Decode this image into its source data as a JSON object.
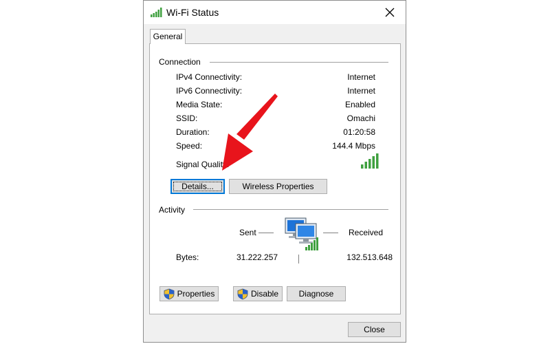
{
  "window": {
    "title": "Wi-Fi Status",
    "tab": "General",
    "close_label": "Close"
  },
  "connection": {
    "group_label": "Connection",
    "rows": [
      {
        "label": "IPv4 Connectivity:",
        "value": "Internet"
      },
      {
        "label": "IPv6 Connectivity:",
        "value": "Internet"
      },
      {
        "label": "Media State:",
        "value": "Enabled"
      },
      {
        "label": "SSID:",
        "value": "Omachi"
      },
      {
        "label": "Duration:",
        "value": "01:20:58"
      },
      {
        "label": "Speed:",
        "value": "144.4 Mbps"
      }
    ],
    "signal_label": "Signal Quality:",
    "signal_bars": 5,
    "details_label": "Details...",
    "wireless_label": "Wireless Properties"
  },
  "activity": {
    "group_label": "Activity",
    "sent_label": "Sent",
    "received_label": "Received",
    "bytes_label": "Bytes:",
    "bytes_sent": "31.222.257",
    "bytes_received": "132.513.648"
  },
  "actions": {
    "properties_label": "Properties",
    "disable_label": "Disable",
    "diagnose_label": "Diagnose"
  },
  "colors": {
    "signal_green": "#3fa03f",
    "focus_blue": "#0078d7",
    "annotation_arrow": "#e8141c"
  },
  "icons": {
    "title": "wifi-signal-icon",
    "network": "network-computers-icon",
    "shield": "uac-shield-icon"
  }
}
